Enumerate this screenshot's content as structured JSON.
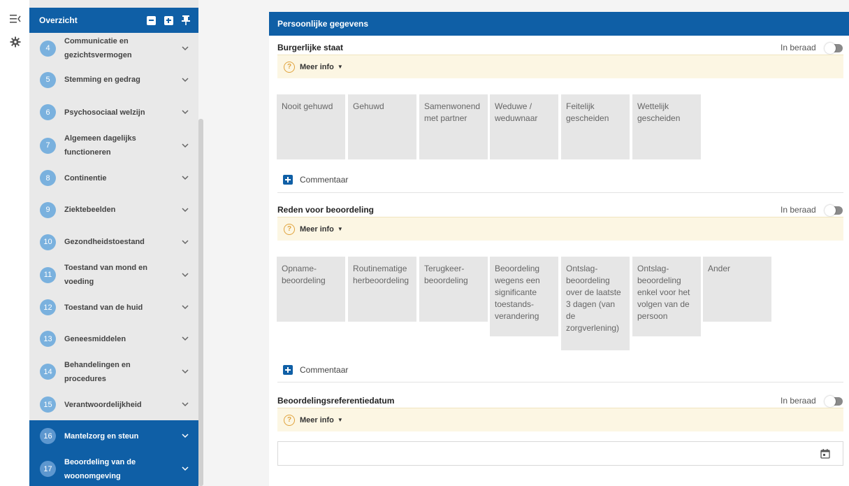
{
  "rail": {
    "collapse_icon": "menu-collapse-icon",
    "settings_icon": "gear-icon"
  },
  "overview": {
    "title": "Overzicht",
    "buttons": [
      "minus-square-icon",
      "plus-square-icon",
      "pin-icon"
    ],
    "items": [
      {
        "num": "4",
        "label": "Communicatie en gezichtsvermogen",
        "active": false
      },
      {
        "num": "5",
        "label": "Stemming en gedrag",
        "active": false
      },
      {
        "num": "6",
        "label": "Psychosociaal welzijn",
        "active": false
      },
      {
        "num": "7",
        "label": "Algemeen dagelijks functioneren",
        "active": false
      },
      {
        "num": "8",
        "label": "Continentie",
        "active": false
      },
      {
        "num": "9",
        "label": "Ziektebeelden",
        "active": false
      },
      {
        "num": "10",
        "label": "Gezondheidstoestand",
        "active": false
      },
      {
        "num": "11",
        "label": "Toestand van mond en voeding",
        "active": false
      },
      {
        "num": "12",
        "label": "Toestand van de huid",
        "active": false
      },
      {
        "num": "13",
        "label": "Geneesmiddelen",
        "active": false
      },
      {
        "num": "14",
        "label": "Behandelingen en procedures",
        "active": false
      },
      {
        "num": "15",
        "label": "Verantwoordelijkheid",
        "active": false
      },
      {
        "num": "16",
        "label": "Mantelzorg en steun",
        "active": true
      },
      {
        "num": "17",
        "label": "Beoordeling van de woonomgeving",
        "active": true
      }
    ]
  },
  "main": {
    "header": "Persoonlijke gegevens",
    "in_beraad": "In beraad",
    "meer_info": "Meer info",
    "commentaar": "Commentaar",
    "sections": {
      "burgerlijke_staat": {
        "title": "Burgerlijke staat",
        "options": [
          "Nooit gehuwd",
          "Gehuwd",
          "Samenwonend met partner",
          "Weduwe / weduwnaar",
          "Feitelijk gescheiden",
          "Wettelijk gescheiden"
        ]
      },
      "reden": {
        "title": "Reden voor beoordeling",
        "options": [
          "Opname-beoordeling",
          "Routinematige herbeoordeling",
          "Terugkeer-beoordeling",
          "Beoordeling wegens een significante toestands-verandering",
          "Ontslag-beoordeling over de laatste 3 dagen (van de zorgverlening)",
          "Ontslag-beoordeling enkel voor het volgen van de persoon",
          "Ander"
        ]
      },
      "datum": {
        "title": "Beoordelingsreferentiedatum",
        "value": "",
        "calendar_icon": "calendar-icon"
      }
    }
  },
  "colors": {
    "primary": "#0f5fa6",
    "info_bg": "#fcf6e3",
    "option_bg": "#e6e6e6",
    "badge": "#7ab1de"
  }
}
